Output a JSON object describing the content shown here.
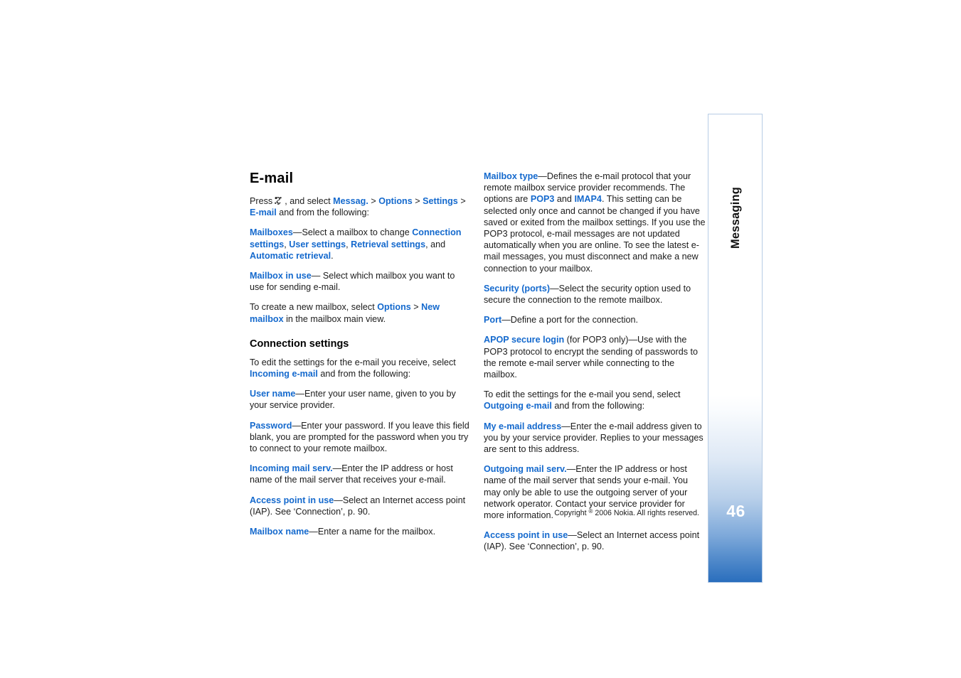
{
  "document": {
    "heading": "E-mail",
    "subheading": "Connection settings"
  },
  "colors": {
    "link": "#1469cd",
    "tab_blue": "#2a6ebd",
    "tab_border": "#b7cce5"
  },
  "left_column": {
    "p_press": {
      "press": "Press",
      "icon": "menu-key-icon",
      "and_select": ", and select",
      "l_messag": "Messag.",
      "gt1": ">",
      "l_options": "Options",
      "gt2": ">",
      "l_settings": "Settings",
      "gt3": ">",
      "l_email": "E-mail",
      "tail": "and from the following:"
    },
    "p_mailboxes": {
      "l_mailboxes": "Mailboxes",
      "t1": "—Select a mailbox to change",
      "l_connection_settings": "Connection settings",
      "comma1": ",",
      "l_user_settings": "User settings",
      "comma2": ",",
      "l_retrieval_settings": "Retrieval settings",
      "t2": ", and",
      "l_automatic_retrieval": "Automatic retrieval",
      "period": "."
    },
    "p_mailbox_in_use": {
      "l_term": "Mailbox in use",
      "t": "— Select which mailbox you want to use for sending e-mail."
    },
    "p_new_mailbox": {
      "t1": "To create a new mailbox, select",
      "l_options": "Options",
      "gt": ">",
      "l_new_mailbox": "New mailbox",
      "t2": "in the mailbox main view."
    },
    "p_to_edit_incoming": {
      "t1": "To edit the settings for the e-mail you receive, select",
      "l_incoming": "Incoming e-mail",
      "t2": "and from the following:"
    },
    "p_user_name": {
      "l_term": "User name",
      "t": "—Enter your user name, given to you by your service provider."
    },
    "p_password": {
      "l_term": "Password",
      "t": "—Enter your password. If you leave this field blank, you are prompted for the password when you try to connect to your remote mailbox."
    },
    "p_incoming_mail_serv": {
      "l_term": "Incoming mail serv.",
      "t": "—Enter the IP address or host name of the mail server that receives your e-mail."
    },
    "p_access_point": {
      "l_term": "Access point in use",
      "t": "—Select an Internet access point (IAP). See ‘Connection’, p. 90."
    },
    "p_mailbox_name": {
      "l_term": "Mailbox name",
      "t": "—Enter a name for the mailbox."
    }
  },
  "right_column": {
    "p_mailbox_type": {
      "l_term": "Mailbox type",
      "t1": "—Defines the e-mail protocol that your remote mailbox service provider recommends. The options are",
      "l_pop3": "POP3",
      "and": "and",
      "l_imap4": "IMAP4",
      "t2": ". This setting can be selected only once and cannot be changed if you have saved or exited from the mailbox settings. If you use the POP3 protocol, e-mail messages are not updated automatically when you are online. To see the latest e-mail messages, you must disconnect and make a new connection to your mailbox."
    },
    "p_security_ports": {
      "l_term": "Security (ports)",
      "t": "—Select the security option used to secure the connection to the remote mailbox."
    },
    "p_port": {
      "l_term": "Port",
      "t": "—Define a port for the connection."
    },
    "p_apop": {
      "l_term": "APOP secure login",
      "t": "(for POP3 only)—Use with the POP3 protocol to encrypt the sending of passwords to the remote e-mail server while connecting to the mailbox."
    },
    "p_to_edit_outgoing": {
      "t1": "To edit the settings for the e-mail you send, select",
      "l_outgoing": "Outgoing e-mail",
      "t2": "and from the following:"
    },
    "p_my_email_address": {
      "l_term": "My e-mail address",
      "t": "—Enter the e-mail address given to you by your service provider. Replies to your messages are sent to this address."
    },
    "p_outgoing_mail_serv": {
      "l_term": "Outgoing mail serv.",
      "t": "—Enter the IP address or host name of the mail server that sends your e-mail. You may only be able to use the outgoing server of your network operator. Contact your service provider for more information."
    },
    "p_access_point": {
      "l_term": "Access point in use",
      "t": "—Select an Internet access point (IAP). See ‘Connection’, p. 90."
    }
  },
  "footer": {
    "copyright_pre": "Copyright",
    "copyright_symbol": "®",
    "copyright_post": "2006 Nokia. All rights reserved."
  },
  "tab": {
    "label": "Messaging",
    "page_number": "46"
  }
}
